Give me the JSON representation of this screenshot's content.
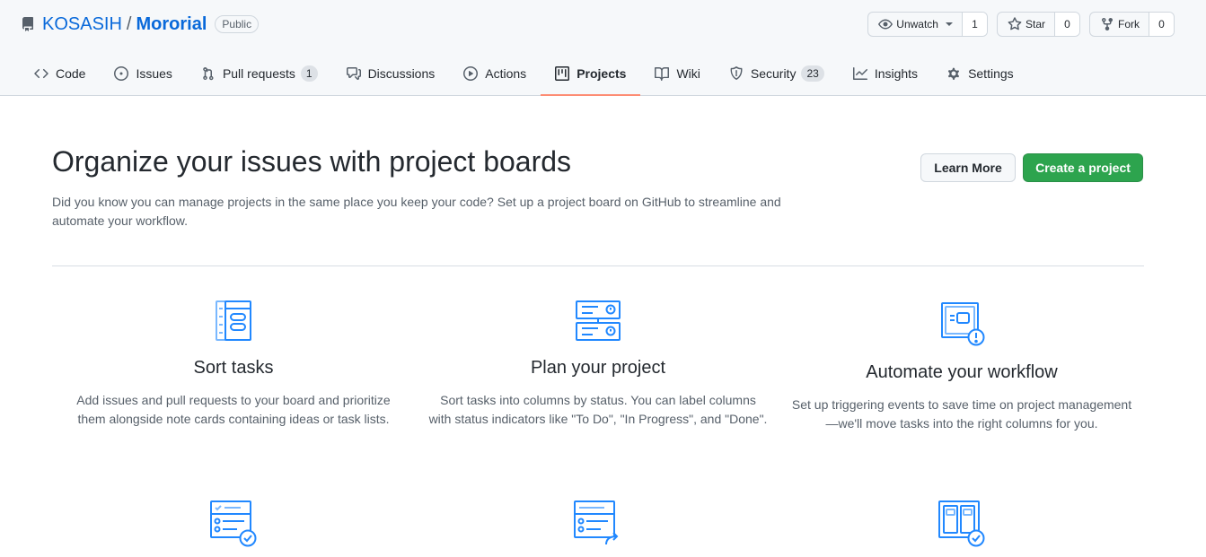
{
  "repo": {
    "owner": "KOSASIH",
    "separator": "/",
    "name": "Mororial",
    "visibility": "Public",
    "icon": "repo-icon"
  },
  "actions": {
    "watch_label": "Unwatch",
    "watch_count": "1",
    "star_label": "Star",
    "star_count": "0",
    "fork_label": "Fork",
    "fork_count": "0"
  },
  "nav": {
    "items": [
      {
        "label": "Code",
        "icon": "code-icon"
      },
      {
        "label": "Issues",
        "icon": "issue-icon"
      },
      {
        "label": "Pull requests",
        "icon": "pull-request-icon",
        "count": "1"
      },
      {
        "label": "Discussions",
        "icon": "discussions-icon"
      },
      {
        "label": "Actions",
        "icon": "play-icon"
      },
      {
        "label": "Projects",
        "icon": "project-icon",
        "selected": true
      },
      {
        "label": "Wiki",
        "icon": "book-icon"
      },
      {
        "label": "Security",
        "icon": "shield-icon",
        "count": "23"
      },
      {
        "label": "Insights",
        "icon": "graph-icon"
      },
      {
        "label": "Settings",
        "icon": "gear-icon"
      }
    ]
  },
  "main": {
    "title": "Organize your issues with project boards",
    "description": "Did you know you can manage projects in the same place you keep your code? Set up a project board on GitHub to streamline and automate your workflow.",
    "learn_more": "Learn More",
    "create_project": "Create a project"
  },
  "features": [
    {
      "title": "Sort tasks",
      "text": "Add issues and pull requests to your board and prioritize them alongside note cards containing ideas or task lists.",
      "icon": "sort-tasks-icon"
    },
    {
      "title": "Plan your project",
      "text": "Sort tasks into columns by status. You can label columns with status indicators like \"To Do\", \"In Progress\", and \"Done\".",
      "icon": "plan-project-icon"
    },
    {
      "title": "Automate your workflow",
      "text": "Set up triggering events to save time on project management—we'll move tasks into the right columns for you.",
      "icon": "automate-workflow-icon"
    }
  ],
  "colors": {
    "link": "#0969da",
    "primary_button": "#2da44e",
    "selected_tab_underline": "#fd8c73",
    "illustration_blue": "#2188ff"
  }
}
